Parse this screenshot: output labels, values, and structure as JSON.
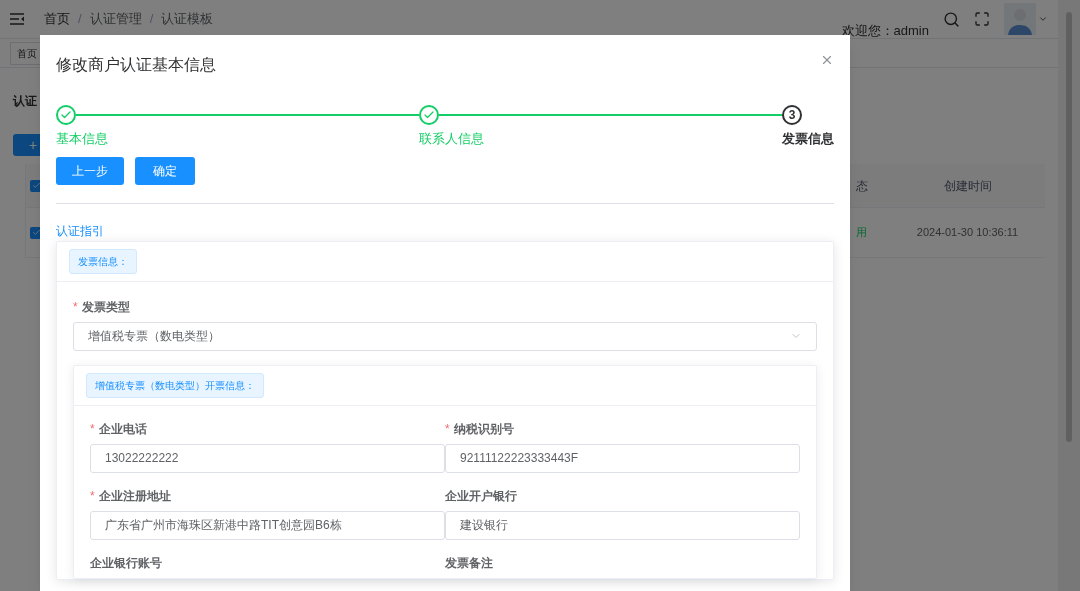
{
  "header": {
    "breadcrumb": [
      "首页",
      "认证管理",
      "认证模板"
    ],
    "separator": "/",
    "welcome": "欢迎您：admin"
  },
  "tabs": [
    {
      "label": "首页",
      "selected": true
    }
  ],
  "page": {
    "title": "认证",
    "add_button": "+",
    "table": {
      "header_checked": true,
      "columns": [
        "态",
        "创建时间"
      ],
      "rows": [
        {
          "checked": true,
          "status": "用",
          "created": "2024-01-30 10:36:11"
        }
      ]
    }
  },
  "dialog": {
    "title": "修改商户认证基本信息",
    "steps": [
      {
        "label": "基本信息",
        "finished": true
      },
      {
        "label": "联系人信息",
        "finished": true
      },
      {
        "label": "发票信息",
        "number": "3",
        "finished": false
      }
    ],
    "buttons": [
      "上一步",
      "确定"
    ],
    "link": "认证指引",
    "card": {
      "tag": "发票信息：",
      "required_mark": "*",
      "select": {
        "label": "发票类型",
        "required": true,
        "value": "增值税专票（数电类型）"
      },
      "sub_card": {
        "tag": "增值税专票（数电类型）开票信息：",
        "fields": [
          {
            "label": "企业电话",
            "required": true,
            "value": "13022222222"
          },
          {
            "label": "纳税识别号",
            "required": true,
            "value": "92111122223333443F"
          },
          {
            "label": "企业注册地址",
            "required": true,
            "value": "广东省广州市海珠区新港中路TIT创意园B6栋"
          },
          {
            "label": "企业开户银行",
            "required": false,
            "value": "建设银行"
          },
          {
            "label": "企业银行账号",
            "required": false
          },
          {
            "label": "发票备注",
            "required": false
          }
        ]
      }
    }
  }
}
